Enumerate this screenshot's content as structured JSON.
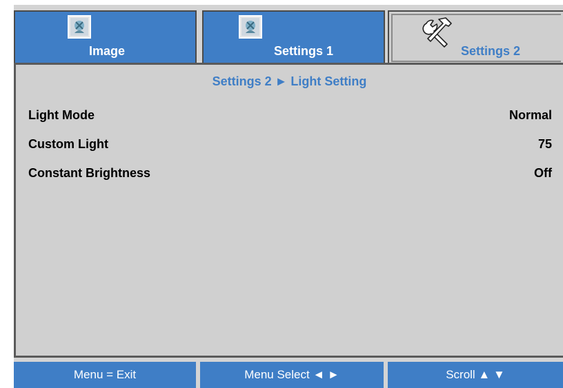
{
  "tabs": [
    {
      "label": "Image",
      "icon": "image-settings-icon",
      "active": true
    },
    {
      "label": "Settings 1",
      "icon": "settings1-icon",
      "active": true
    },
    {
      "label": "Settings 2",
      "icon": "tools-icon",
      "active": false
    }
  ],
  "panel": {
    "title": "Settings 2 ► Light Setting",
    "rows": [
      {
        "label": "Light Mode",
        "value": "Normal"
      },
      {
        "label": "Custom Light",
        "value": "75"
      },
      {
        "label": "Constant Brightness",
        "value": "Off"
      }
    ]
  },
  "footer": {
    "exit": "Menu = Exit",
    "select": "Menu Select ◄ ►",
    "scroll": "Scroll ▲ ▼"
  },
  "colors": {
    "accent": "#3f7ec6",
    "panel_bg": "#d0d0d0",
    "frame_bg": "#d4d4d4"
  }
}
